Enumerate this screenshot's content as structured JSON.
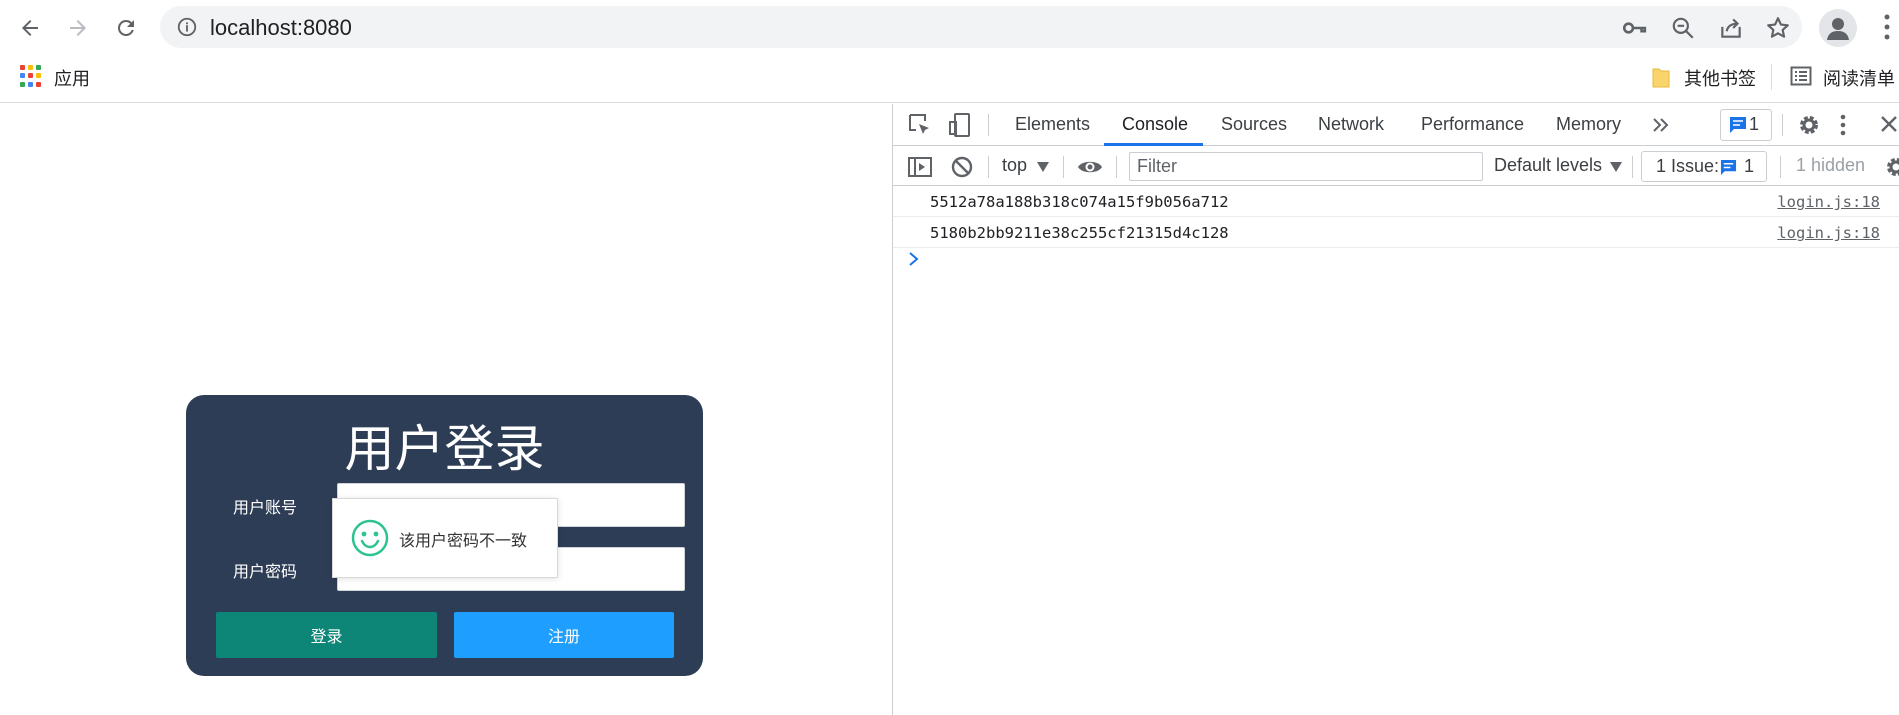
{
  "browser": {
    "url": "localhost:8080",
    "bookmarks": {
      "apps_label": "应用",
      "other_label": "其他书签",
      "reading_list_label": "阅读清单"
    }
  },
  "page": {
    "login": {
      "title": "用户登录",
      "account_label": "用户账号",
      "password_label": "用户密码",
      "login_button": "登录",
      "register_button": "注册"
    },
    "toast": {
      "icon": "smiley-icon",
      "message": "该用户密码不一致"
    }
  },
  "devtools": {
    "tabs": [
      "Elements",
      "Console",
      "Sources",
      "Network",
      "Performance",
      "Memory"
    ],
    "active_tab": "Console",
    "issues_badge_count": "1",
    "console": {
      "context": "top",
      "filter_placeholder": "Filter",
      "levels": "Default levels",
      "issues_label": "1 Issue:",
      "issues_count": "1",
      "hidden_label": "1 hidden",
      "messages": [
        {
          "text": "5512a78a188b318c074a15f9b056a712",
          "source": "login.js:18"
        },
        {
          "text": "5180b2bb9211e38c255cf21315d4c128",
          "source": "login.js:18"
        }
      ]
    }
  },
  "colors": {
    "card_bg": "#2d3d56",
    "login_btn": "#0d8577",
    "register_btn": "#1e9fff",
    "accent_blue": "#1a73e8"
  }
}
